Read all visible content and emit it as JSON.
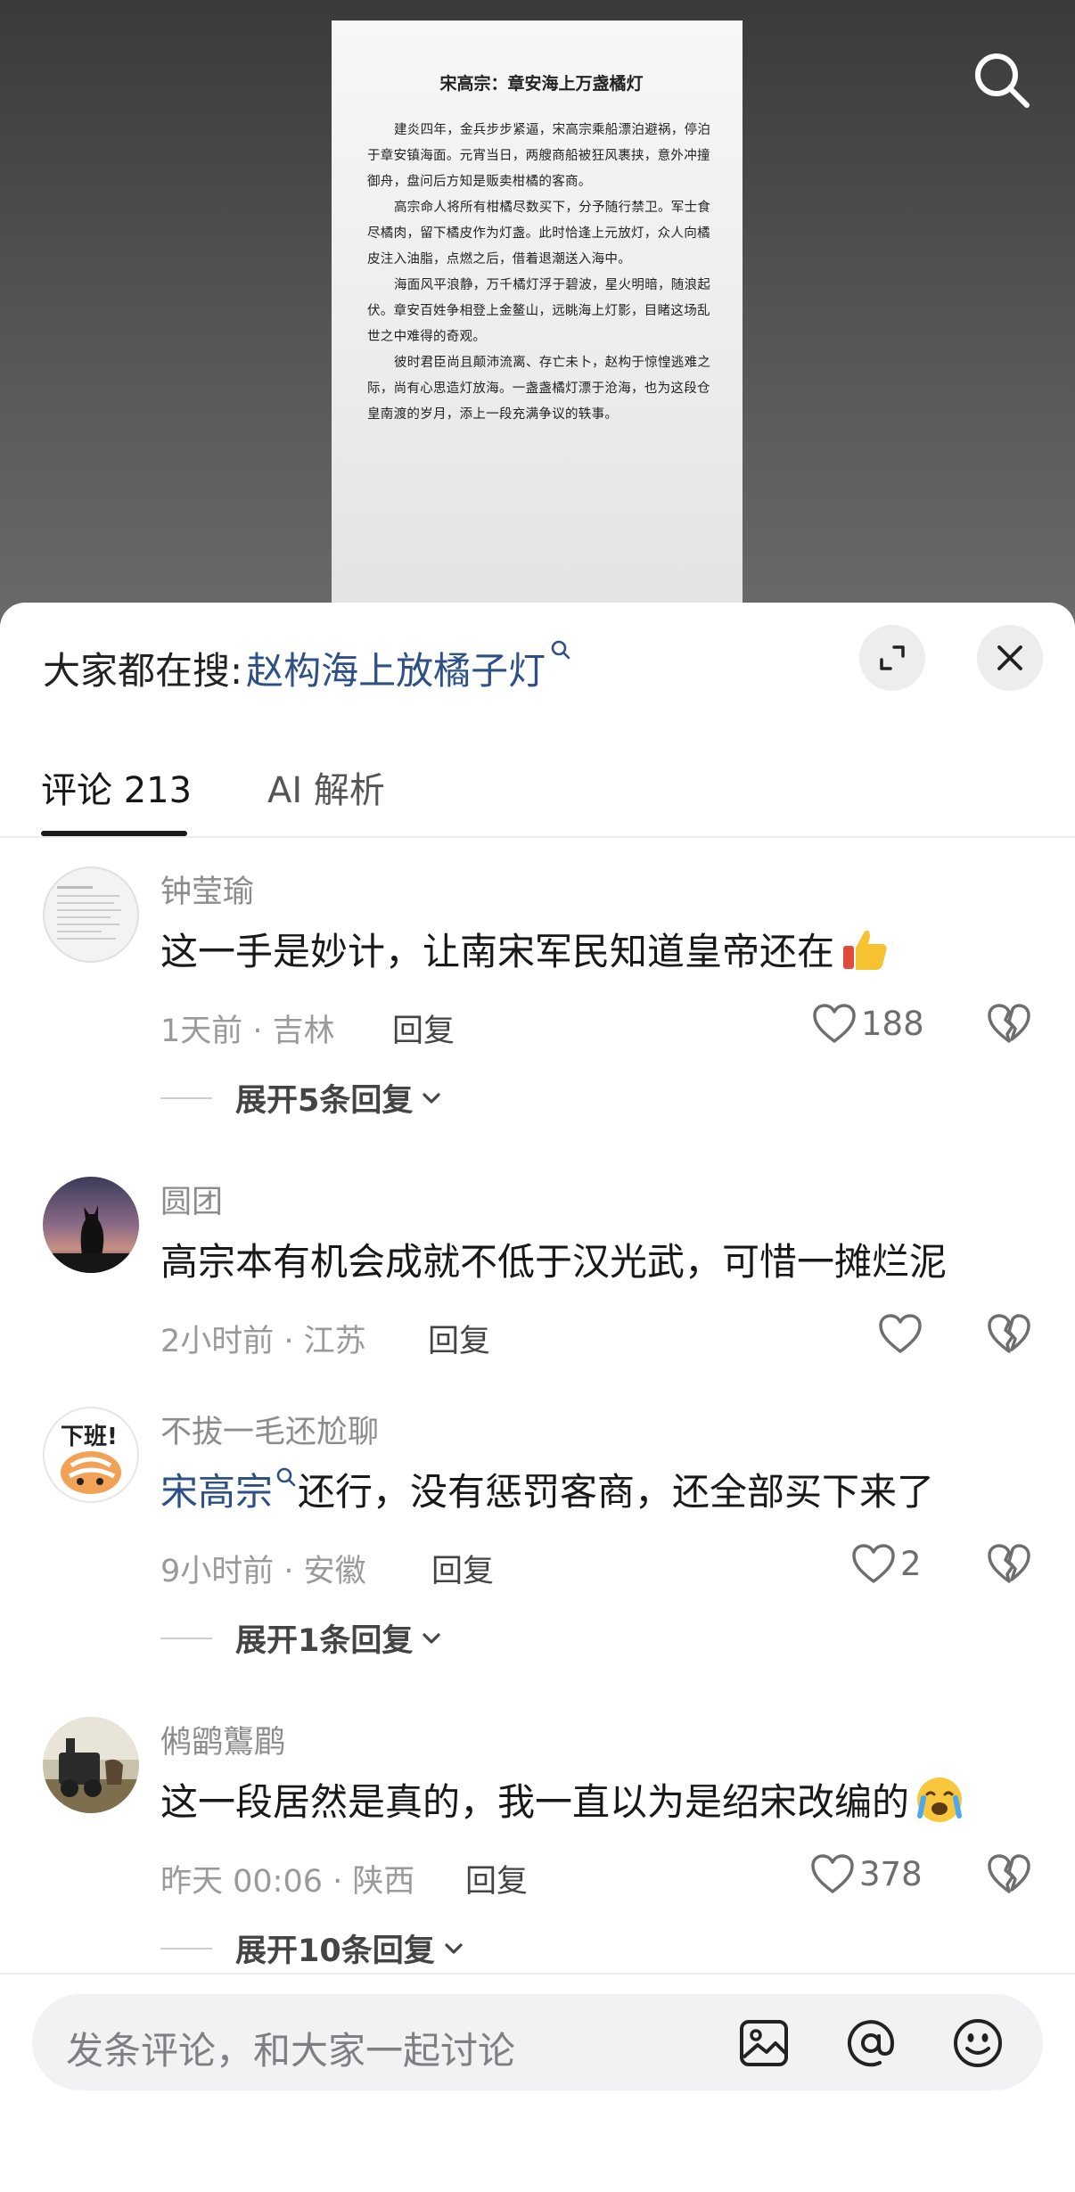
{
  "document": {
    "title": "宋高宗：章安海上万盏橘灯",
    "paragraphs": [
      "建炎四年，金兵步步紧逼，宋高宗乘船漂泊避祸，停泊于章安镇海面。元宵当日，两艘商船被狂风裹挟，意外冲撞御舟，盘问后方知是贩卖柑橘的客商。",
      "高宗命人将所有柑橘尽数买下，分予随行禁卫。军士食尽橘肉，留下橘皮作为灯盏。此时恰逢上元放灯，众人向橘皮注入油脂，点燃之后，借着退潮送入海中。",
      "海面风平浪静，万千橘灯浮于碧波，星火明暗，随浪起伏。章安百姓争相登上金鳌山，远眺海上灯影，目睹这场乱世之中难得的奇观。",
      "彼时君臣尚且颠沛流离、存亡未卜，赵构于惊惶逃难之际，尚有心思造灯放海。一盏盏橘灯漂于沧海，也为这段仓皇南渡的岁月，添上一段充满争议的轶事。"
    ]
  },
  "header": {
    "hot_search_prefix": "大家都在搜:",
    "hot_search_term": "赵构海上放橘子灯"
  },
  "tabs": {
    "comments_label": "评论 213",
    "ai_label": "AI 解析"
  },
  "comments": [
    {
      "user": "钟莹瑜",
      "text": "这一手是妙计，让南宋军民知道皇帝还在",
      "meta": "1天前 · 吉林",
      "reply": "回复",
      "likes": "188",
      "expand": "展开5条回复",
      "emoji": "thumbs-up-emoji"
    },
    {
      "user": "圆团",
      "text": "高宗本有机会成就不低于汉光武，可惜一摊烂泥",
      "meta": "2小时前 · 江苏",
      "reply": "回复",
      "likes": ""
    },
    {
      "user": "不拔一毛还尬聊",
      "link": "宋高宗",
      "text": "还行，没有惩罚客商，还全部买下来了",
      "meta": "9小时前 · 安徽",
      "reply": "回复",
      "likes": "2",
      "expand": "展开1条回复",
      "avatar_text": "下班!"
    },
    {
      "user": "鸺鹠鸗鹛",
      "text": "这一段居然是真的，我一直以为是绍宋改编的",
      "meta": "昨天 00:06 · 陕西",
      "reply": "回复",
      "likes": "378",
      "expand": "展开10条回复",
      "emoji": "crying-emoji"
    }
  ],
  "input": {
    "placeholder": "发条评论，和大家一起讨论"
  },
  "colors": {
    "link": "#2d5187",
    "text_primary": "#181818",
    "text_secondary": "#9a9a9a"
  }
}
